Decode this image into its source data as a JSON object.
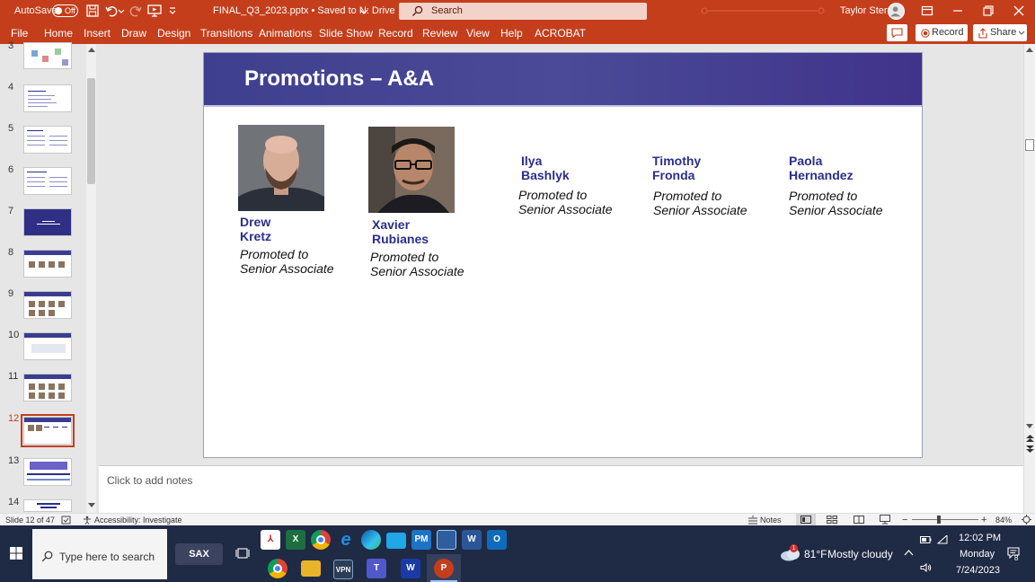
{
  "titlebar": {
    "autosave_label": "AutoSave",
    "autosave_state": "Off",
    "file_title": "FINAL_Q3_2023.pptx • Saved to N: Drive",
    "search_placeholder": "Search",
    "user_name": "Taylor Stern"
  },
  "menu": {
    "tabs": [
      "File",
      "Home",
      "Insert",
      "Draw",
      "Design",
      "Transitions",
      "Animations",
      "Slide Show",
      "Record",
      "Review",
      "View",
      "Help",
      "ACROBAT"
    ],
    "record_button": "Record",
    "share_button": "Share"
  },
  "thumbnails": {
    "numbers": [
      "3",
      "4",
      "5",
      "6",
      "7",
      "8",
      "9",
      "10",
      "11",
      "12",
      "13",
      "14"
    ],
    "selected": "12"
  },
  "slide": {
    "title": "Promotions – A&A",
    "people": [
      {
        "first": "Drew",
        "last": "Kretz",
        "line1": "Promoted to",
        "line2": "Senior Associate"
      },
      {
        "first": "Xavier",
        "last": "Rubianes",
        "line1": "Promoted to",
        "line2": "Senior Associate"
      },
      {
        "first": "Ilya",
        "last": "Bashlyk",
        "line1": "Promoted to",
        "line2": "Senior Associate"
      },
      {
        "first": "Timothy",
        "last": "Fronda",
        "line1": "Promoted to",
        "line2": "Senior Associate"
      },
      {
        "first": "Paola",
        "last": "Hernandez",
        "line1": "Promoted to",
        "line2": "Senior Associate"
      }
    ]
  },
  "notes": {
    "placeholder": "Click to add notes"
  },
  "status": {
    "slide_counter": "Slide 12 of 47",
    "accessibility": "Accessibility: Investigate",
    "notes_button": "Notes",
    "zoom": "84%"
  },
  "taskbar": {
    "search_placeholder": "Type here to search",
    "sax_label": "SAX",
    "weather_temp": "81°F",
    "weather_desc": "Mostly cloudy",
    "weather_badge": "1",
    "time": "12:02 PM",
    "day": "Monday",
    "date": "7/24/2023",
    "notification_count": "8"
  },
  "colors": {
    "ppt_accent": "#c43e1c",
    "slide_header": "#42428f",
    "name_color": "#2b2d8a",
    "taskbar": "#1f2a44"
  }
}
